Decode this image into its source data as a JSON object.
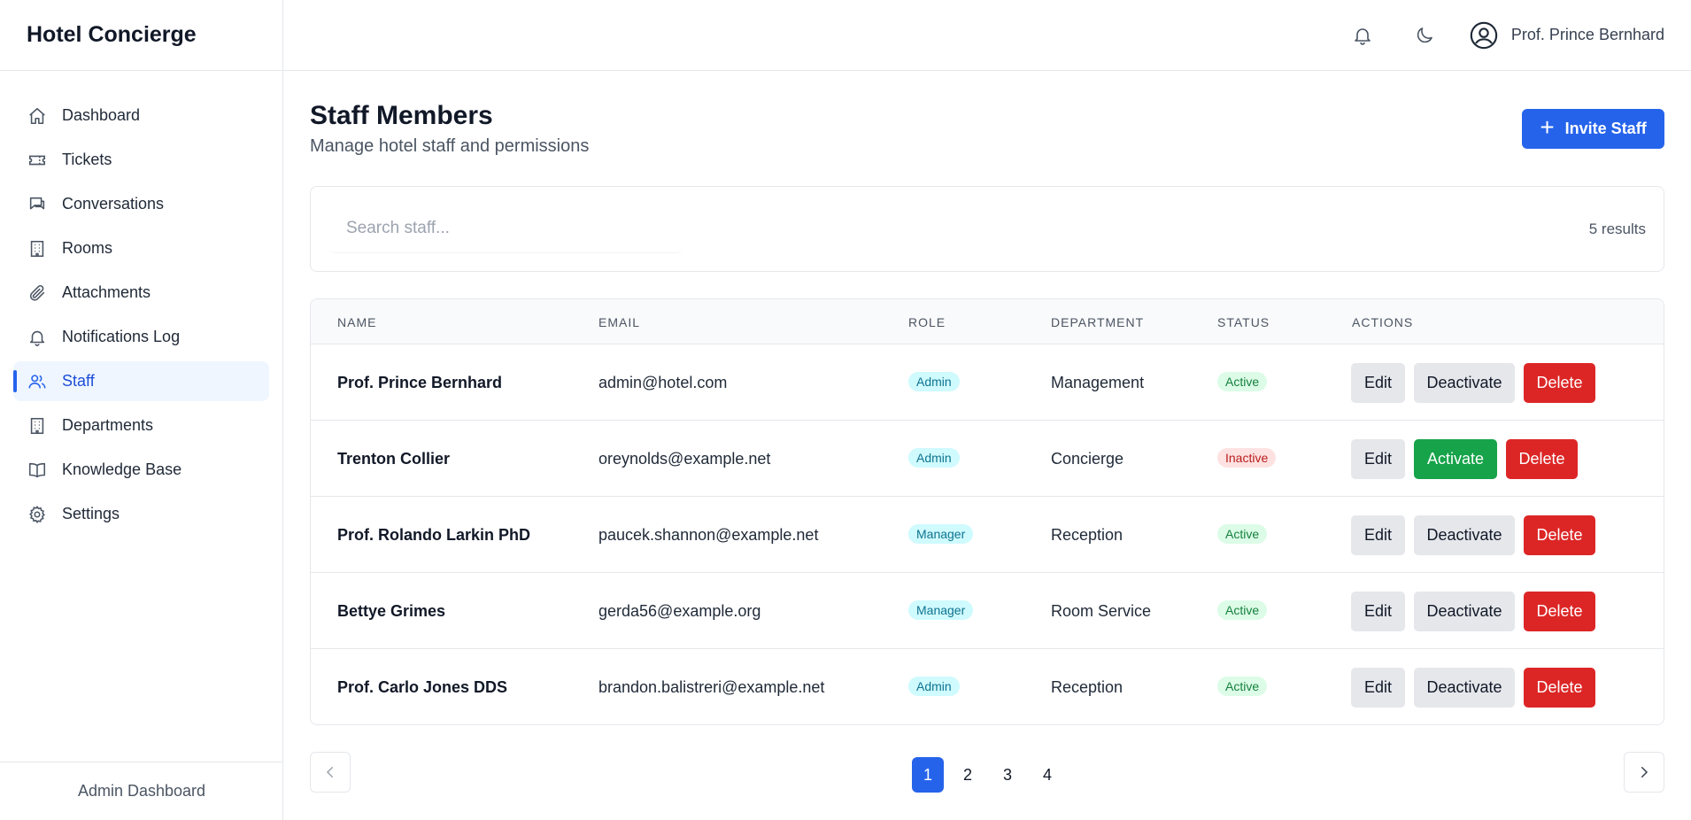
{
  "app": {
    "title": "Hotel Concierge"
  },
  "sidebar": {
    "items": [
      {
        "label": "Dashboard",
        "icon": "home-icon"
      },
      {
        "label": "Tickets",
        "icon": "ticket-icon"
      },
      {
        "label": "Conversations",
        "icon": "chat-icon"
      },
      {
        "label": "Rooms",
        "icon": "building-icon"
      },
      {
        "label": "Attachments",
        "icon": "paperclip-icon"
      },
      {
        "label": "Notifications Log",
        "icon": "bell-icon"
      },
      {
        "label": "Staff",
        "icon": "users-icon",
        "active": true
      },
      {
        "label": "Departments",
        "icon": "building-icon"
      },
      {
        "label": "Knowledge Base",
        "icon": "book-icon"
      },
      {
        "label": "Settings",
        "icon": "gear-icon"
      }
    ],
    "footer": "Admin Dashboard"
  },
  "topbar": {
    "user_name": "Prof. Prince Bernhard"
  },
  "page": {
    "title": "Staff Members",
    "subtitle": "Manage hotel staff and permissions",
    "invite_label": "Invite Staff"
  },
  "search": {
    "placeholder": "Search staff...",
    "value": "",
    "results": "5 results"
  },
  "table": {
    "headers": {
      "name": "Name",
      "email": "Email",
      "role": "Role",
      "department": "Department",
      "status": "Status",
      "actions": "Actions"
    },
    "rows": [
      {
        "name": "Prof. Prince Bernhard",
        "email": "admin@hotel.com",
        "role": "Admin",
        "department": "Management",
        "status": "Active",
        "toggle": "Deactivate"
      },
      {
        "name": "Trenton Collier",
        "email": "oreynolds@example.net",
        "role": "Admin",
        "department": "Concierge",
        "status": "Inactive",
        "toggle": "Activate"
      },
      {
        "name": "Prof. Rolando Larkin PhD",
        "email": "paucek.shannon@example.net",
        "role": "Manager",
        "department": "Reception",
        "status": "Active",
        "toggle": "Deactivate"
      },
      {
        "name": "Bettye Grimes",
        "email": "gerda56@example.org",
        "role": "Manager",
        "department": "Room Service",
        "status": "Active",
        "toggle": "Deactivate"
      },
      {
        "name": "Prof. Carlo Jones DDS",
        "email": "brandon.balistreri@example.net",
        "role": "Admin",
        "department": "Reception",
        "status": "Active",
        "toggle": "Deactivate"
      }
    ],
    "edit_label": "Edit",
    "delete_label": "Delete"
  },
  "pagination": {
    "pages": [
      "1",
      "2",
      "3",
      "4"
    ],
    "current": "1"
  },
  "colors": {
    "primary": "#2563eb",
    "success": "#16a34a",
    "danger": "#dc2626"
  }
}
